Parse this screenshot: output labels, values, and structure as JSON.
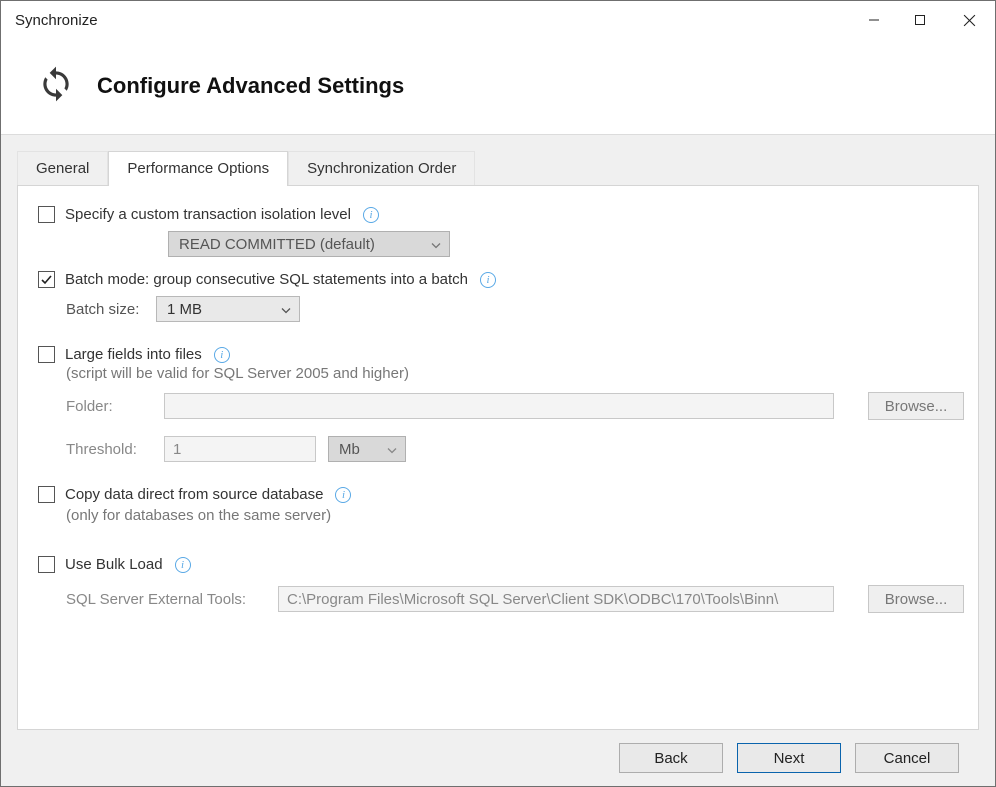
{
  "window": {
    "title": "Synchronize"
  },
  "header": {
    "title": "Configure Advanced Settings"
  },
  "tabs": {
    "general": "General",
    "performance": "Performance Options",
    "order": "Synchronization Order"
  },
  "opts": {
    "isolation_label": "Specify a custom transaction isolation level",
    "isolation_value": "READ COMMITTED (default)",
    "batch_label": "Batch mode: group consecutive SQL statements into a batch",
    "batch_size_label": "Batch size:",
    "batch_size_value": "1 MB",
    "large_fields_label": "Large fields into files",
    "large_fields_hint": "(script will be valid for SQL Server 2005 and higher)",
    "folder_label": "Folder:",
    "folder_value": "",
    "threshold_label": "Threshold:",
    "threshold_value": "1",
    "threshold_unit": "Mb",
    "copy_direct_label": "Copy data direct from source database",
    "copy_direct_hint": "(only for databases on the same server)",
    "bulk_load_label": "Use Bulk Load",
    "ext_tools_label": "SQL Server External Tools:",
    "ext_tools_value": "C:\\Program Files\\Microsoft SQL Server\\Client SDK\\ODBC\\170\\Tools\\Binn\\",
    "browse": "Browse..."
  },
  "footer": {
    "back": "Back",
    "next": "Next",
    "cancel": "Cancel"
  }
}
